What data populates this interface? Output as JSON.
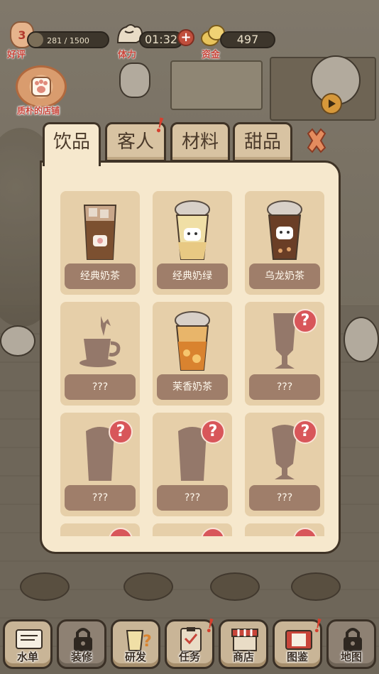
{
  "hud": {
    "reputation": {
      "level": "3",
      "progress_text": "281 / 1500",
      "progress_fraction": 0.187,
      "label": "好评"
    },
    "stamina": {
      "time": "01:32",
      "label": "体力"
    },
    "funds": {
      "value": "497",
      "label": "资金"
    },
    "shop": {
      "label": "质朴的店铺"
    }
  },
  "tabs": [
    {
      "label": "饮品",
      "active": true
    },
    {
      "label": "客人",
      "active": false,
      "alert": "!"
    },
    {
      "label": "材料",
      "active": false
    },
    {
      "label": "甜品",
      "active": false
    }
  ],
  "items": [
    {
      "name": "经典奶茶",
      "unlocked": true,
      "art": "iced-milk-tea-cup"
    },
    {
      "name": "经典奶绿",
      "unlocked": true,
      "art": "green-milk-tea-cup"
    },
    {
      "name": "乌龙奶茶",
      "unlocked": true,
      "art": "oolong-milk-tea-cup"
    },
    {
      "name": "???",
      "unlocked": false,
      "art": "teacup-silhouette"
    },
    {
      "name": "茉香奶茶",
      "unlocked": true,
      "art": "jasmine-milk-tea-cup"
    },
    {
      "name": "???",
      "unlocked": false,
      "art": "goblet-silhouette",
      "badge": "?"
    },
    {
      "name": "???",
      "unlocked": false,
      "art": "cup-silhouette",
      "badge": "?"
    },
    {
      "name": "???",
      "unlocked": false,
      "art": "cup-silhouette",
      "badge": "?"
    },
    {
      "name": "???",
      "unlocked": false,
      "art": "parfait-silhouette",
      "badge": "?"
    }
  ],
  "nav": [
    {
      "label": "水单",
      "locked": false,
      "icon": "menu-book-icon"
    },
    {
      "label": "装修",
      "locked": true,
      "icon": "lock-icon"
    },
    {
      "label": "研发",
      "locked": false,
      "icon": "research-cup-icon"
    },
    {
      "label": "任务",
      "locked": false,
      "icon": "clipboard-icon",
      "alert": "!"
    },
    {
      "label": "商店",
      "locked": false,
      "icon": "store-icon"
    },
    {
      "label": "图鉴",
      "locked": false,
      "icon": "album-icon",
      "alert": "!"
    },
    {
      "label": "地图",
      "locked": true,
      "icon": "lock-icon"
    }
  ],
  "colors": {
    "panel": "#f6e8cd",
    "card": "#e6cfa9",
    "label_pill": "#9f7e6a",
    "alert_red": "#d5402f",
    "border": "#3f3326"
  }
}
